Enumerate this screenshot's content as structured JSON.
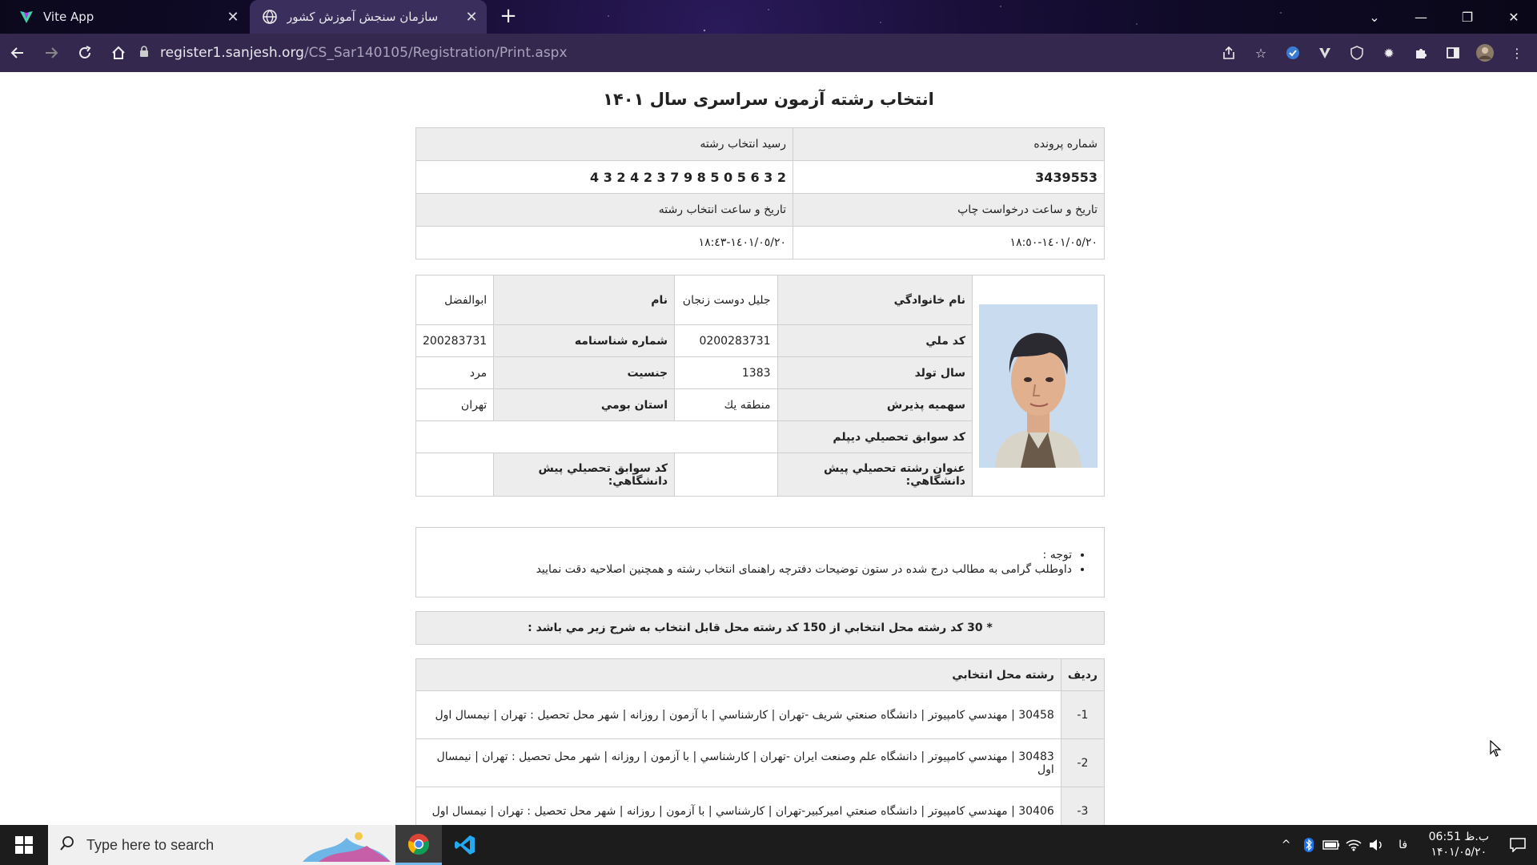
{
  "browser": {
    "tabs": [
      {
        "title": "Vite App",
        "active": false
      },
      {
        "title": "سازمان سنجش آموزش کشور",
        "active": true
      }
    ],
    "url_host": "register1.sanjesh.org",
    "url_path": "/CS_Sar140105/Registration/Print.aspx"
  },
  "page": {
    "title": "انتخاب رشته آزمون سراسری سال ۱۴۰۱",
    "file_number_label": "شماره پرونده",
    "receipt_label": "رسید انتخاب رشته",
    "file_number_value": "3439553",
    "receipt_value": "4 3 2 4 2 3 7 9 8 5 0 5 6 3 2",
    "print_datetime_label": "تاریخ و ساعت درخواست چاپ",
    "selection_datetime_label": "تاریخ و ساعت انتخاب رشته",
    "print_datetime_value": "١٤٠١/٠٥/٢٠-١٨:٥٠",
    "selection_datetime_value": "١٤٠١/٠٥/٢٠-١٨:٤٣",
    "person": {
      "last_name_label": "نام خانوادگي",
      "last_name_value": "جليل دوست زنجان",
      "first_name_label": "نام",
      "first_name_value": "ابوالفضل",
      "national_code_label": "كد ملي",
      "national_code_value": "0200283731",
      "id_number_label": "شماره شناسنامه",
      "id_number_value": "200283731",
      "birth_year_label": "سال تولد",
      "birth_year_value": "1383",
      "gender_label": "جنسيت",
      "gender_value": "مرد",
      "quota_label": "سهميه پذيرش",
      "quota_value": "منطقه يك",
      "province_label": "استان بومي",
      "province_value": "تهران",
      "diploma_code_label": "كد سوابق تحصيلي ديپلم",
      "preuni_title_label": "عنوان رشته تحصيلي پيش دانشگاهي:",
      "preuni_code_label": "كد سوابق تحصيلي پيش دانشگاهي:"
    },
    "notice": {
      "title": "توجه :",
      "text": "داوطلب گرامی به مطالب درج شده در ستون توضیحات دفترچه راهنمای انتخاب رشته و همچنین اصلاحیه دقت نمایید"
    },
    "banner": "* 30 كد رشته محل انتخابي از 150 كد رشته محل قابل انتخاب به شرح زير مي باشد :",
    "choices_header": {
      "row": "رديف",
      "choice": "رشته محل انتخابي"
    },
    "choices": [
      {
        "row": "-1",
        "text": "30458 | مهندسي كامپيوتر | دانشگاه صنعتي شريف -تهران | كارشناسي | با آزمون | روزانه | شهر محل تحصيل : تهران | نيمسال اول"
      },
      {
        "row": "-2",
        "text": "30483 | مهندسي كامپيوتر | دانشگاه علم وصنعت ايران -تهران | كارشناسي | با آزمون | روزانه | شهر محل تحصيل : تهران | نيمسال اول"
      },
      {
        "row": "-3",
        "text": "30406 | مهندسي كامپيوتر | دانشگاه صنعتي اميركبير-تهران | كارشناسي | با آزمون | روزانه | شهر محل تحصيل : تهران | نيمسال اول"
      }
    ]
  },
  "taskbar": {
    "search_placeholder": "Type here to search",
    "lang": "فا",
    "time": "06:51 ب.ظ",
    "date": "۱۴۰۱/۰۵/۲۰"
  }
}
